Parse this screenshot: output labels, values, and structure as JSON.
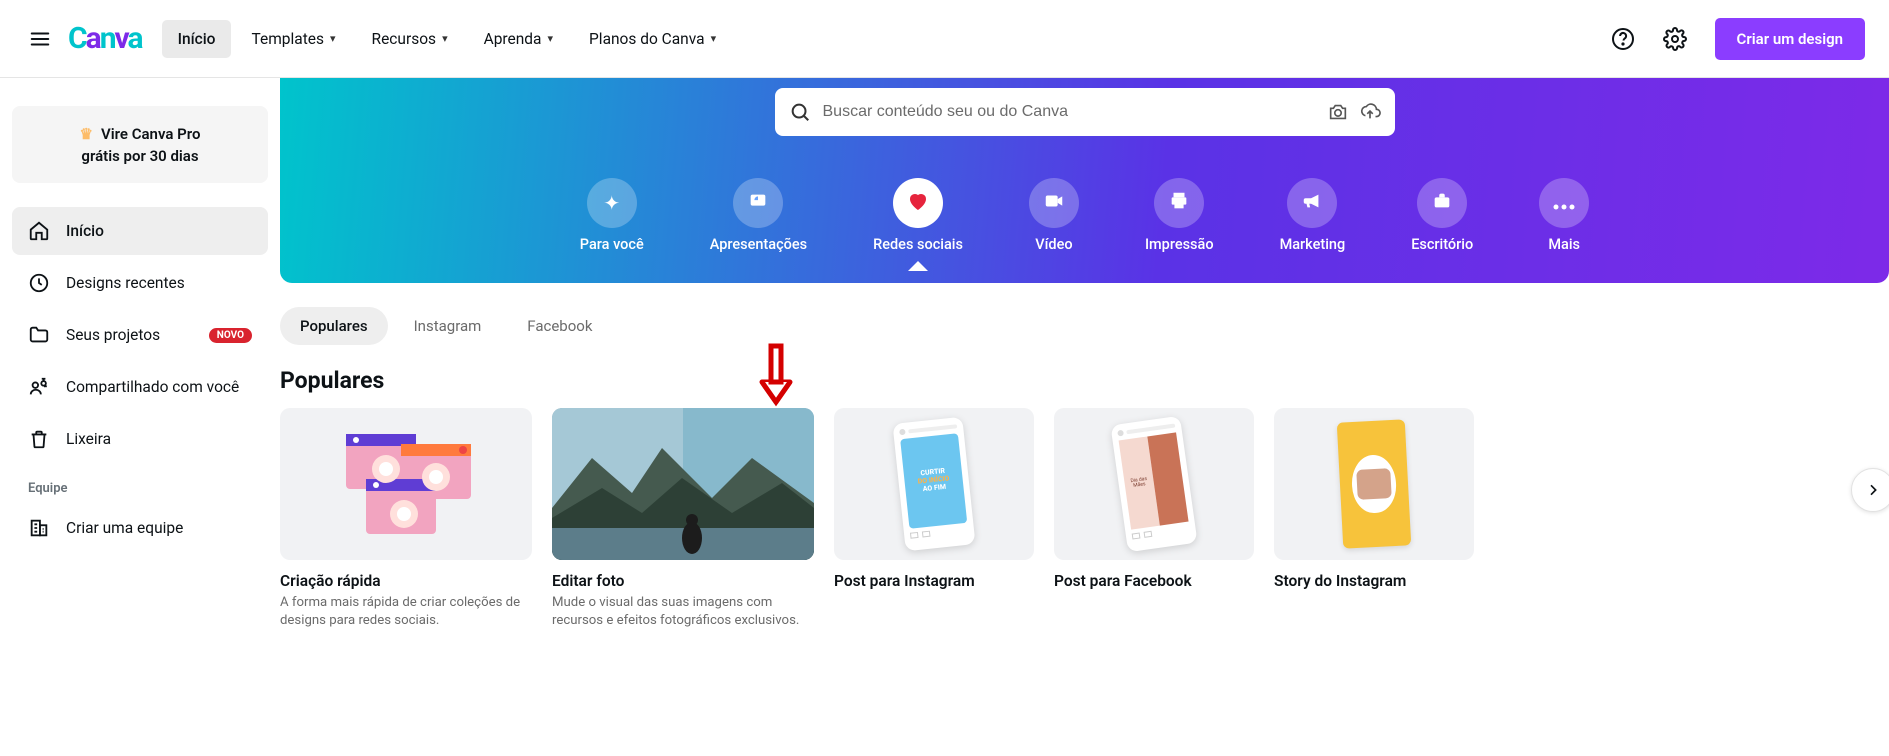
{
  "header": {
    "nav": [
      {
        "label": "Início",
        "active": true
      },
      {
        "label": "Templates",
        "active": false,
        "dropdown": true
      },
      {
        "label": "Recursos",
        "active": false,
        "dropdown": true
      },
      {
        "label": "Aprenda",
        "active": false,
        "dropdown": true
      },
      {
        "label": "Planos do Canva",
        "active": false,
        "dropdown": true
      }
    ],
    "cta": "Criar um design"
  },
  "sidebar": {
    "pro": {
      "line1": "Vire Canva Pro",
      "line2": "grátis por 30 dias"
    },
    "items": [
      {
        "label": "Início",
        "icon": "home",
        "active": true
      },
      {
        "label": "Designs recentes",
        "icon": "clock"
      },
      {
        "label": "Seus projetos",
        "icon": "folder",
        "badge": "NOVO"
      },
      {
        "label": "Compartilhado com você",
        "icon": "share"
      },
      {
        "label": "Lixeira",
        "icon": "trash"
      }
    ],
    "team_heading": "Equipe",
    "team_item": {
      "label": "Criar uma equipe",
      "icon": "building"
    }
  },
  "hero": {
    "search_placeholder": "Buscar conteúdo seu ou do Canva",
    "categories": [
      {
        "label": "Para você",
        "icon": "sparkle"
      },
      {
        "label": "Apresentações",
        "icon": "presentation"
      },
      {
        "label": "Redes sociais",
        "icon": "heart",
        "active": true
      },
      {
        "label": "Vídeo",
        "icon": "video"
      },
      {
        "label": "Impressão",
        "icon": "printer"
      },
      {
        "label": "Marketing",
        "icon": "megaphone"
      },
      {
        "label": "Escritório",
        "icon": "briefcase"
      },
      {
        "label": "Mais",
        "icon": "more"
      }
    ]
  },
  "tabs": [
    {
      "label": "Populares",
      "active": true
    },
    {
      "label": "Instagram"
    },
    {
      "label": "Facebook"
    }
  ],
  "section_title": "Populares",
  "cards": [
    {
      "title": "Criação rápida",
      "desc": "A forma mais rápida de criar coleções de designs para redes sociais."
    },
    {
      "title": "Editar foto",
      "desc": "Mude o visual das suas imagens com recursos e efeitos fotográficos exclusivos."
    },
    {
      "title": "Post para Instagram",
      "desc": ""
    },
    {
      "title": "Post para Facebook",
      "desc": ""
    },
    {
      "title": "Story do Instagram",
      "desc": ""
    }
  ]
}
